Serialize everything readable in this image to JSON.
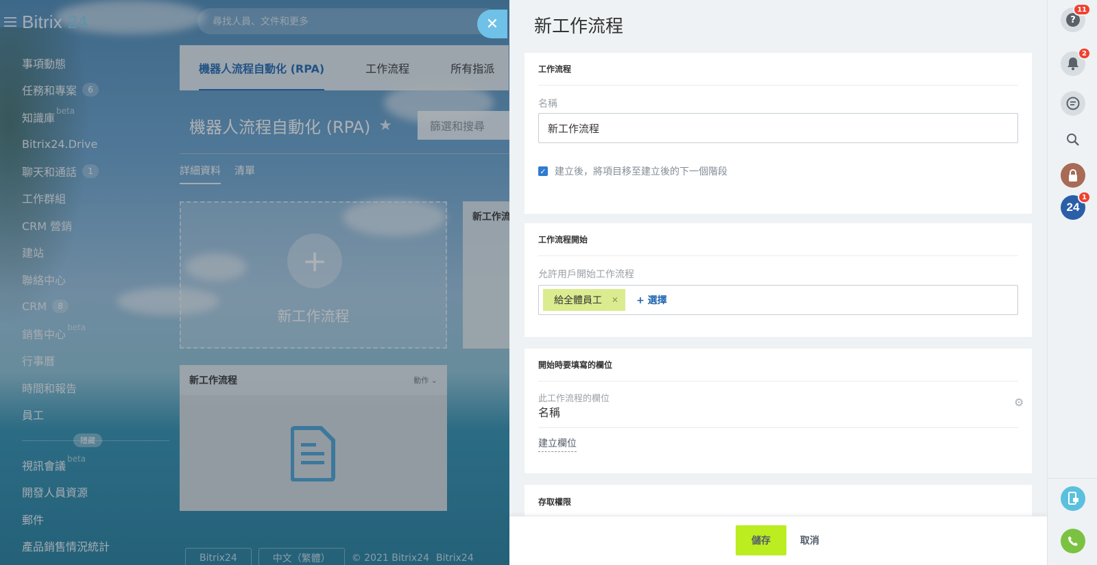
{
  "app": {
    "logo_main": "Bitrix",
    "logo_num": "24"
  },
  "search": {
    "placeholder": "尋找人員、文件和更多"
  },
  "sidebar": {
    "items": [
      {
        "label": "事項動態",
        "count": "",
        "sup": ""
      },
      {
        "label": "任務和專案",
        "count": "6",
        "sup": ""
      },
      {
        "label": "知識庫",
        "count": "",
        "sup": "beta"
      },
      {
        "label": "Bitrix24.Drive",
        "count": "",
        "sup": ""
      },
      {
        "label": "聊天和通話",
        "count": "1",
        "sup": ""
      },
      {
        "label": "工作群組",
        "count": "",
        "sup": ""
      },
      {
        "label": "CRM 營銷",
        "count": "",
        "sup": ""
      },
      {
        "label": "建站",
        "count": "",
        "sup": ""
      },
      {
        "label": "聯絡中心",
        "count": "",
        "sup": ""
      },
      {
        "label": "CRM",
        "count": "8",
        "sup": ""
      },
      {
        "label": "銷售中心",
        "count": "",
        "sup": "beta"
      },
      {
        "label": "行事曆",
        "count": "",
        "sup": ""
      },
      {
        "label": "時間和報告",
        "count": "",
        "sup": ""
      },
      {
        "label": "員工",
        "count": "",
        "sup": ""
      }
    ],
    "hidden_label": "隱藏",
    "items_after": [
      {
        "label": "視訊會議",
        "count": "",
        "sup": "beta"
      },
      {
        "label": "開發人員資源",
        "count": "",
        "sup": ""
      },
      {
        "label": "郵件",
        "count": "",
        "sup": ""
      },
      {
        "label": "產品銷售情況統計",
        "count": "",
        "sup": ""
      }
    ]
  },
  "background": {
    "tabs": [
      "機器人流程自動化 (RPA)",
      "工作流程",
      "所有指派"
    ],
    "page_title": "機器人流程自動化 (RPA)",
    "filter_placeholder": "篩選和搜尋",
    "subtabs": [
      "詳細資料",
      "清單"
    ],
    "new_card_label": "新工作流程",
    "card2_title": "新工作流",
    "card3_title": "新工作流程",
    "card3_action": "動作",
    "footer": [
      "Bitrix24",
      "中文（繁體）",
      "© 2021 Bitrix24",
      "Bitrix24"
    ]
  },
  "panel": {
    "title": "新工作流程",
    "section_workflow": {
      "heading": "工作流程",
      "name_label": "名稱",
      "name_value": "新工作流程",
      "checkbox_label": "建立後，將項目移至建立後的下一個階段",
      "checkbox_checked": true
    },
    "section_start": {
      "heading": "工作流程開始",
      "users_label": "允許用戶開始工作流程",
      "tag": "給全體員工",
      "add_label": "+ 選擇"
    },
    "section_fields": {
      "heading": "開始時要填寫的欄位",
      "fields_label": "此工作流程的欄位",
      "field_name": "名稱",
      "create_field": "建立欄位"
    },
    "section_access": {
      "heading": "存取權限"
    },
    "footer": {
      "save_label": "儲存",
      "cancel_label": "取消"
    }
  },
  "right_rail": {
    "help_badge": "11",
    "notifications_badge": "2",
    "b24_badge": "1",
    "b24_label": "24"
  },
  "colors": {
    "accent": "#2067b0",
    "save": "#bbed21",
    "tag": "#daec8f",
    "badge": "#f0412f"
  }
}
